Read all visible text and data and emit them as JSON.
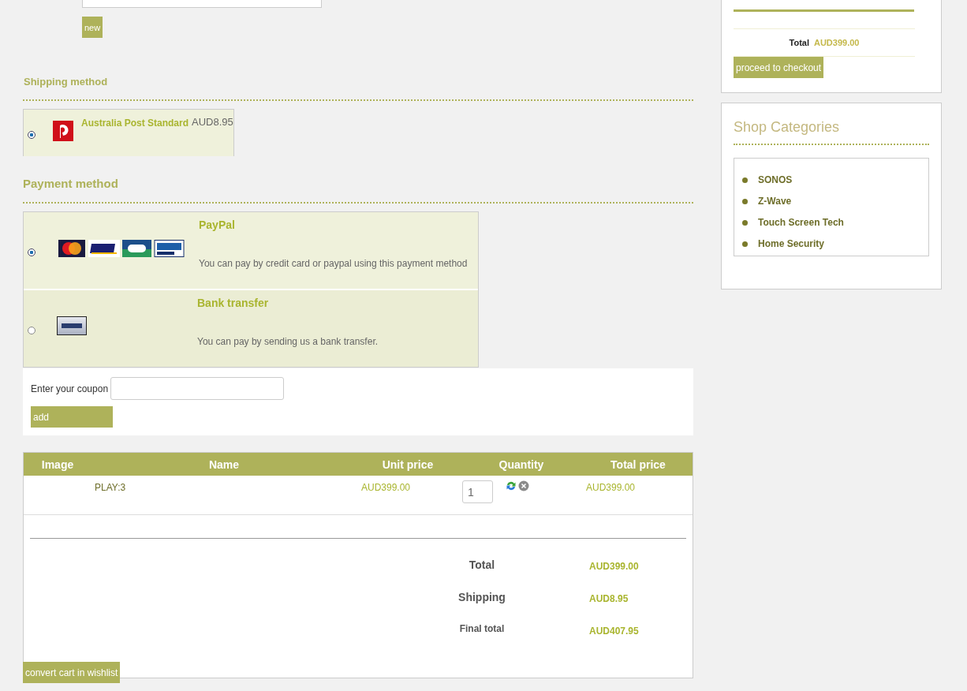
{
  "new_button": "new",
  "shipping": {
    "title": "Shipping method",
    "options": [
      {
        "selected": true,
        "name": "Australia Post Standard",
        "price": "AUD8.95"
      }
    ]
  },
  "payment": {
    "title": "Payment method",
    "options": [
      {
        "kind": "cards",
        "selected": true,
        "name": "PayPal",
        "description": "You can pay by credit card or paypal using this payment method"
      },
      {
        "kind": "bank",
        "selected": false,
        "name": "Bank transfer",
        "description": "You can pay by sending us a bank transfer."
      }
    ]
  },
  "coupon": {
    "label": "Enter your coupon",
    "button": "add"
  },
  "cart": {
    "columns": [
      "Image",
      "Name",
      "Unit price",
      "Quantity",
      "Total price"
    ],
    "rows": [
      {
        "name": "PLAY:3",
        "unit_price": "AUD399.00",
        "quantity": "1",
        "total_price": "AUD399.00"
      }
    ],
    "totals": [
      {
        "kind": "major",
        "label": "Total",
        "value": "AUD399.00"
      },
      {
        "kind": "major",
        "label": "Shipping",
        "value": "AUD8.95"
      },
      {
        "kind": "minor",
        "label": "Final total",
        "value": "AUD407.95"
      }
    ],
    "wishlist_button": "convert cart in wishlist"
  },
  "cart_summary": {
    "total_label": "Total",
    "total_value": "AUD399.00",
    "checkout_button": "proceed to checkout"
  },
  "categories": {
    "title": "Shop Categories",
    "items": [
      "SONOS",
      "Z-Wave",
      "Touch Screen Tech",
      "Home Security"
    ]
  }
}
